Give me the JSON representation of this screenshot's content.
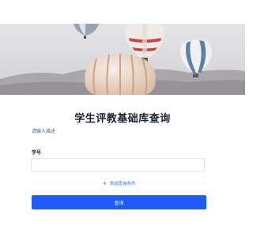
{
  "banner": {
    "image": "hot-air-balloons-image"
  },
  "page": {
    "title": "学生评教基础库查询",
    "description": "请输入描述"
  },
  "form": {
    "fields": [
      {
        "label": "学号",
        "value": "",
        "placeholder": ""
      }
    ],
    "add_condition_label": "添加查询条件",
    "submit_label": "查询"
  },
  "colors": {
    "primary": "#1f5cf5",
    "link": "#2f6bf6",
    "title": "#1c2333"
  }
}
